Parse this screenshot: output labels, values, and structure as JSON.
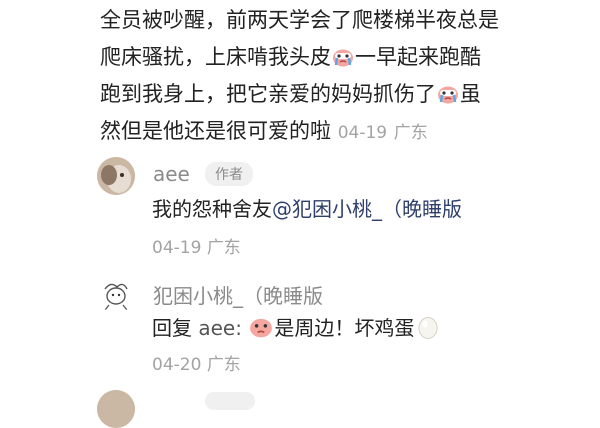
{
  "top_comment": {
    "line1": "全员被吵醒，前两天学会了爬楼梯半夜总是",
    "line2a": "爬床骚扰，上床啃我头皮",
    "line2b": "一早起来跑酷",
    "line3a": "跑到我身上，把它亲爱的妈妈抓伤了",
    "line3b": "虽",
    "line4": "然但是他还是很可爱的啦",
    "date": "04-19",
    "location": "广东"
  },
  "reply1": {
    "author": "aee",
    "author_tag": "作者",
    "text_prefix": "我的怨种舍友",
    "mention": "@犯困小桃_（晚睡版",
    "date": "04-19",
    "location": "广东"
  },
  "reply2": {
    "author": "犯困小桃_（晚睡版",
    "reply_prefix": "回复",
    "reply_target": "aee:",
    "text": "是周边！坏鸡蛋",
    "date": "04-20",
    "location": "广东"
  },
  "colors": {
    "text": "#222222",
    "meta": "#a3a3a3",
    "mention": "#2f3f6b",
    "tag_bg": "#f0f0f0"
  }
}
